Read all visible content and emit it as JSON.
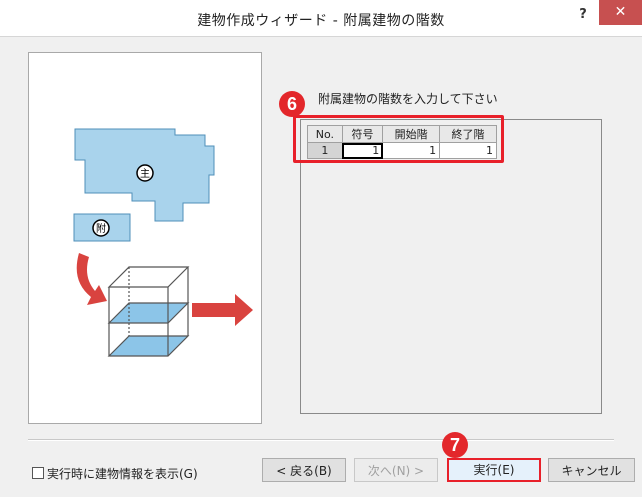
{
  "window": {
    "title": "建物作成ウィザード - 附属建物の階数",
    "help_label": "?",
    "close_label": "✕"
  },
  "illustration": {
    "main_label": "主",
    "annex_label": "附"
  },
  "form": {
    "prompt": "附属建物の階数を入力して下さい",
    "columns": [
      "No.",
      "符号",
      "開始階",
      "終了階"
    ],
    "rows": [
      {
        "no": "1",
        "code": "1",
        "start_floor": "1",
        "end_floor": "1"
      }
    ]
  },
  "annotations": {
    "step6": "6",
    "step7": "7",
    "accent_color": "#e3272b"
  },
  "footer": {
    "checkbox_label": "実行時に建物情報を表示(G)",
    "checkbox_checked": false,
    "back_button": "< 戻る(B)",
    "next_button": "次へ(N) >",
    "execute_button": "実行(E)",
    "cancel_button": "キャンセル"
  }
}
